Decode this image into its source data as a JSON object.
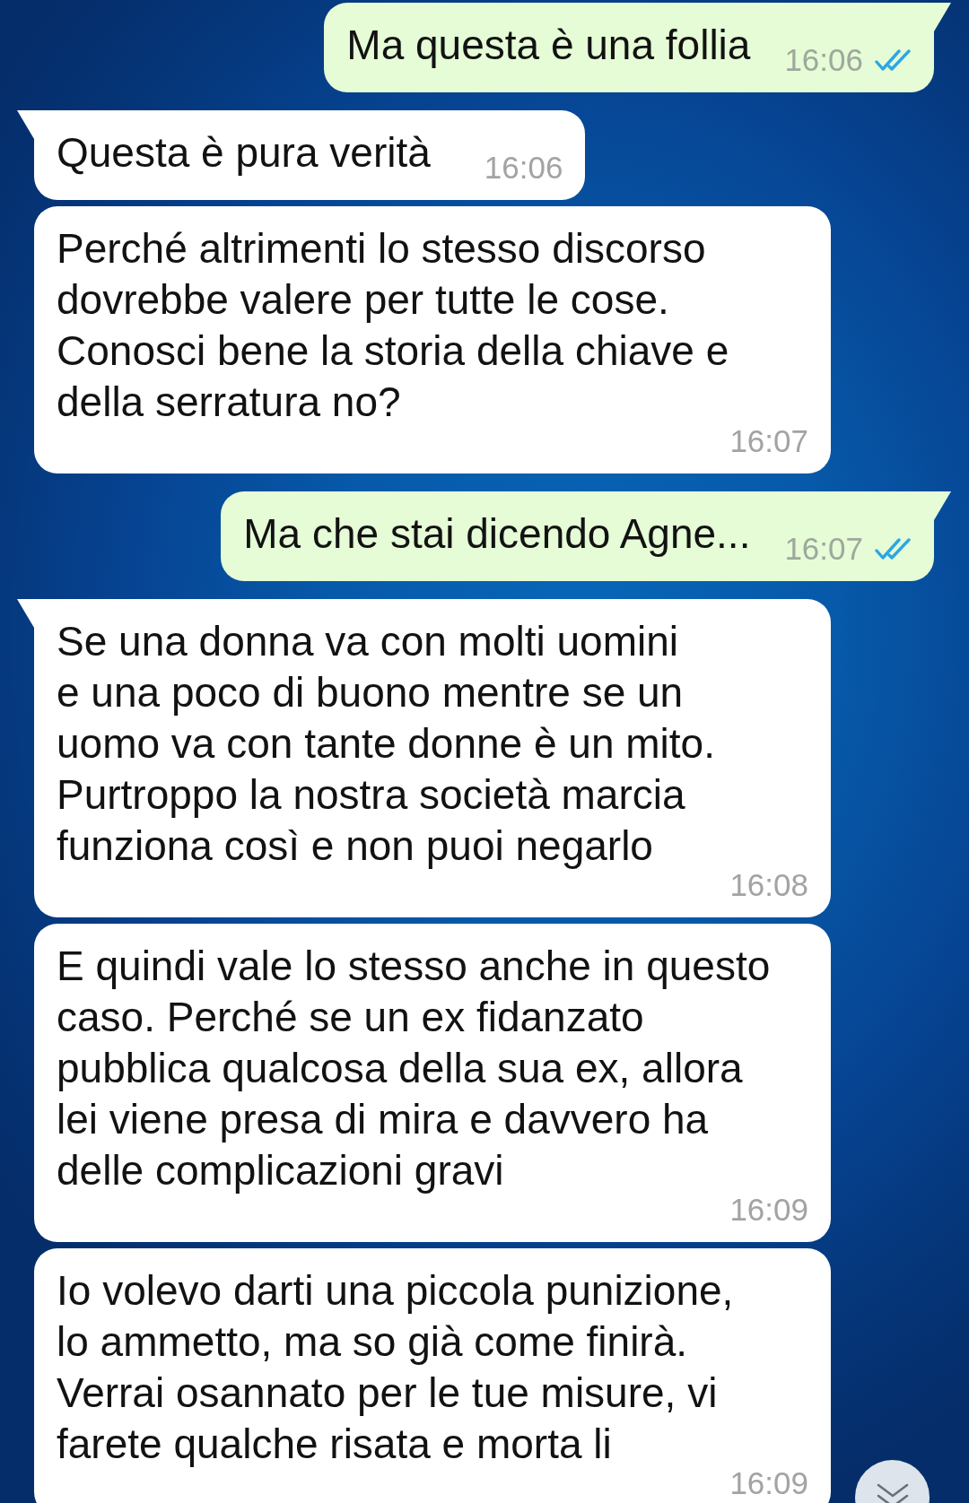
{
  "messages": [
    {
      "kind": "outgoing",
      "tail": true,
      "text": "Ma questa è una follia",
      "time": "16:06",
      "read": true
    },
    {
      "kind": "incoming",
      "tail": true,
      "text": "Questa è pura verità",
      "time": "16:06"
    },
    {
      "kind": "incoming",
      "tail": false,
      "text": "Perché altrimenti lo stesso discorso\ndovrebbe valere per tutte le cose.\nConosci bene la storia della chiave e\ndella serratura no?",
      "time": "16:07"
    },
    {
      "kind": "outgoing",
      "tail": true,
      "text": "Ma che stai dicendo Agne...",
      "time": "16:07",
      "read": true
    },
    {
      "kind": "incoming",
      "tail": true,
      "text": "Se una donna va con molti uomini\ne una poco di buono mentre se un\nuomo va con tante donne è un mito.\nPurtroppo la nostra società marcia\nfunziona così e non puoi negarlo",
      "time": "16:08"
    },
    {
      "kind": "incoming",
      "tail": false,
      "text": "E quindi vale lo stesso anche in questo\ncaso. Perché se un ex fidanzato\npubblica qualcosa della sua ex, allora\nlei viene presa di mira e davvero ha\ndelle complicazioni gravi",
      "time": "16:09"
    },
    {
      "kind": "incoming",
      "tail": false,
      "text": "Io volevo darti una piccola punizione,\nlo ammetto, ma so già come finirà.\nVerrai osannato per le tue misure, vi\nfarete qualche risata e morta li",
      "time": "16:09"
    }
  ]
}
